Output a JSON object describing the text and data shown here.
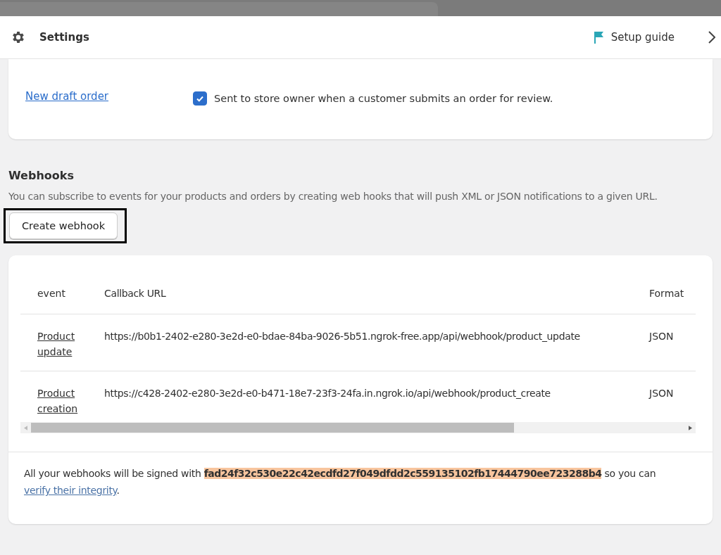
{
  "header": {
    "title": "Settings",
    "setup_guide": "Setup guide"
  },
  "notification": {
    "link": "New draft order",
    "checked": true,
    "description": "Sent to store owner when a customer submits an order for review."
  },
  "webhooks": {
    "title": "Webhooks",
    "description": "You can subscribe to events for your products and orders by creating web hooks that will push XML or JSON notifications to a given URL.",
    "button": "Create webhook"
  },
  "table": {
    "columns": [
      "event",
      "Callback URL",
      "Format"
    ],
    "rows": [
      {
        "event": "Product update",
        "url": "https://b0b1-2402-e280-3e2d-e0-bdae-84ba-9026-5b51.ngrok-free.app/api/webhook/product_update",
        "format": "JSON"
      },
      {
        "event": "Product creation",
        "url": "https://c428-2402-e280-3e2d-e0-b471-18e7-23f3-24fa.in.ngrok.io/api/webhook/product_create",
        "format": "JSON"
      }
    ]
  },
  "signing": {
    "before": "All your webhooks will be signed with",
    "key": "fad24f32c530e22c42ecdfd27f049dfdd2c559135102fb17444790ee723288b4",
    "after": "so you can",
    "link": "verify their integrity",
    "end": "."
  }
}
